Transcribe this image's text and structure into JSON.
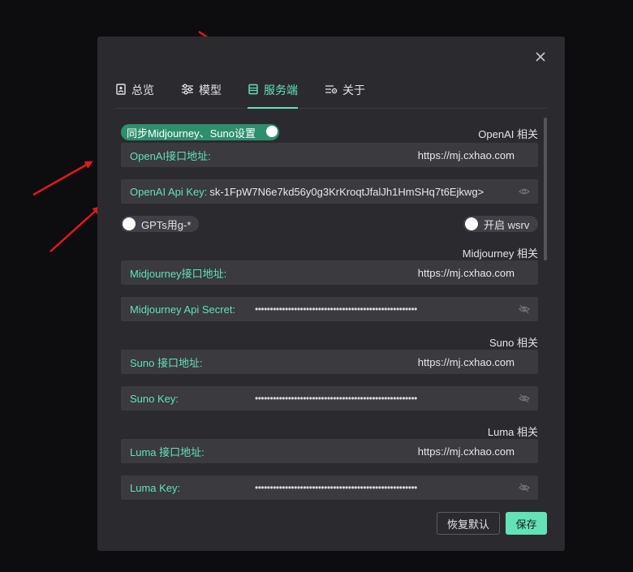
{
  "tabs": [
    {
      "label": "总览",
      "icon": "overview-icon"
    },
    {
      "label": "模型",
      "icon": "sliders-icon"
    },
    {
      "label": "服务端",
      "icon": "server-icon"
    },
    {
      "label": "关于",
      "icon": "about-settings-icon"
    }
  ],
  "active_tab": "服务端",
  "sync_toggle": {
    "label": "同步Midjourney、Suno设置",
    "on": true
  },
  "openai": {
    "section_title": "OpenAI 相关",
    "endpoint_label": "OpenAI接口地址:",
    "endpoint_value": "https://mj.cxhao.com",
    "key_label": "OpenAI Api Key:",
    "key_value": "sk-1FpW7N6e7kd56y0g3KrKroqtJfalJh1HmSHq7t6Ejkwg>"
  },
  "gpts_toggle": {
    "label": "GPTs用g-*",
    "on": false
  },
  "wsrv_toggle": {
    "label": "开启 wsrv",
    "on": false
  },
  "midjourney": {
    "section_title": "Midjourney 相关",
    "endpoint_label": "Midjourney接口地址:",
    "endpoint_value": "https://mj.cxhao.com",
    "secret_label": "Midjourney Api Secret:",
    "secret_mask": "••••••••••••••••••••••••••••••••••••••••••••••••••••••"
  },
  "suno": {
    "section_title": "Suno 相关",
    "endpoint_label": "Suno 接口地址:",
    "endpoint_value": "https://mj.cxhao.com",
    "key_label": "Suno Key:",
    "key_mask": "••••••••••••••••••••••••••••••••••••••••••••••••••••••"
  },
  "luma": {
    "section_title": "Luma 相关",
    "endpoint_label": "Luma 接口地址:",
    "endpoint_value": "https://mj.cxhao.com",
    "key_label": "Luma Key:",
    "key_mask": "••••••••••••••••••••••••••••••••••••••••••••••••••••••"
  },
  "footer": {
    "reset_label": "恢复默认",
    "save_label": "保存"
  },
  "colors": {
    "accent": "#63e2b7",
    "panel": "#2b2b2f",
    "field": "#3a3a3f",
    "annotation_arrow": "#e0191b"
  }
}
